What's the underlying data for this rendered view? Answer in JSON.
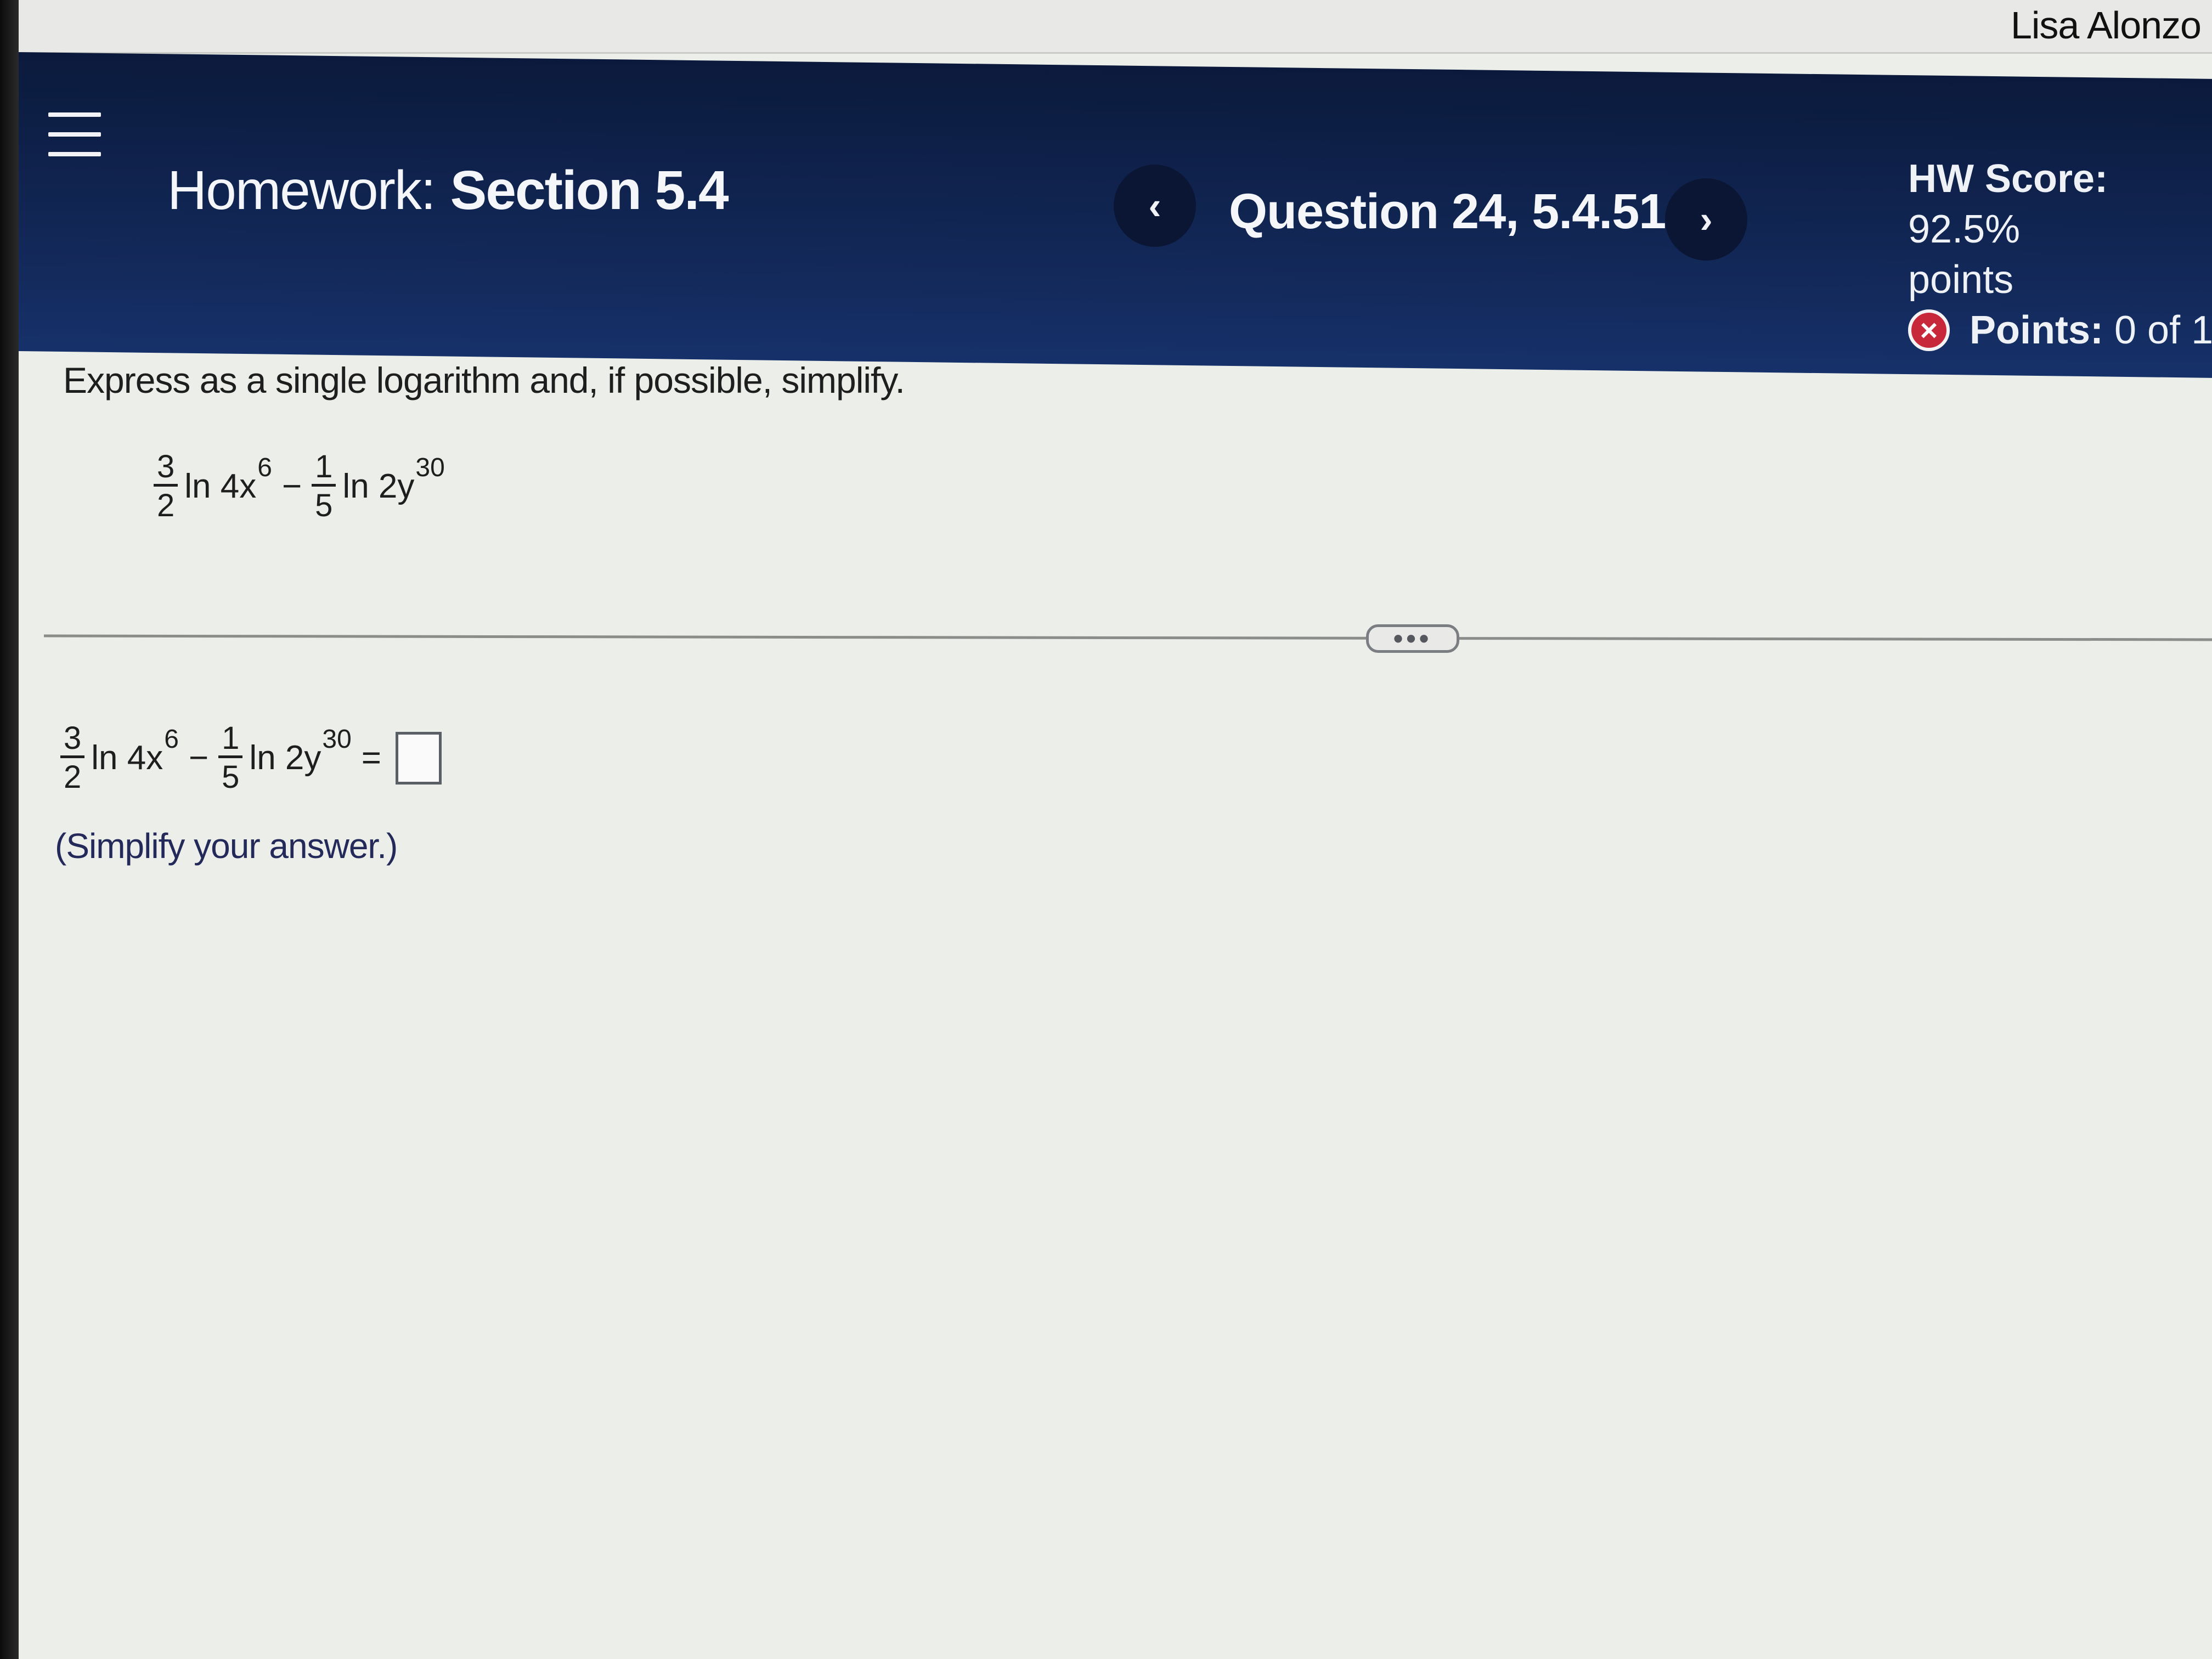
{
  "user": {
    "name": "Lisa Alonzo"
  },
  "header": {
    "title_label": "Homework:",
    "title_section": "Section 5.4",
    "question_label": "Question 24, 5.4.51",
    "prev_icon": "‹",
    "next_icon": "›"
  },
  "score": {
    "hw_score_label": "HW Score:",
    "hw_score_value": "92.5%",
    "points_word": "points",
    "points_label": "Points:",
    "points_value": "0 of 1",
    "incorrect_icon": "×"
  },
  "question": {
    "prompt": "Express as a single logarithm and, if possible, simplify.",
    "term1": {
      "coef_num": "3",
      "coef_den": "2",
      "func": "ln 4x",
      "exp": "6"
    },
    "operator": "−",
    "term2": {
      "coef_num": "1",
      "coef_den": "5",
      "func": "ln 2y",
      "exp": "30"
    },
    "equals": "=",
    "answer_value": ""
  },
  "divider": {
    "more_label": "•••"
  },
  "hint": "(Simplify your answer.)"
}
